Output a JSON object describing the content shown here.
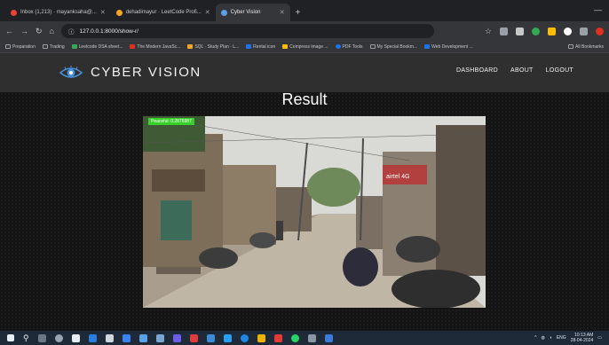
{
  "browser": {
    "tabs": [
      {
        "label": "Inbox (1,213) · mayanksaha@...",
        "color": "#ea4335",
        "active": false
      },
      {
        "label": "dehadimayur · LeetCode Profi...",
        "color": "#f5a623",
        "active": false
      },
      {
        "label": "Cyber Vision",
        "color": "#5aa0e6",
        "active": true
      }
    ],
    "url": "127.0.0.1:8000/show-r/",
    "bookmarks": [
      "Preparation",
      "Trading",
      "Leetcode DSA sheet...",
      "The Modern JavaSc...",
      "SQL · Study Plan · L...",
      "Rental icon",
      "Compress image ...",
      "PDF Tools",
      "My Special Bookm...",
      "Web Development ...",
      "All Bookmarks"
    ]
  },
  "app": {
    "brand": "CYBER VISION",
    "nav": {
      "dashboard": "DASHBOARD",
      "about": "ABOUT",
      "logout": "LOGOUT"
    },
    "result_title": "Result",
    "detection_label": "Peaceful: 0.2876987",
    "accent": "#38d12b"
  },
  "taskbar": {
    "time": "10:13 AM",
    "date": "28-04-2024",
    "lang": "ENG"
  }
}
